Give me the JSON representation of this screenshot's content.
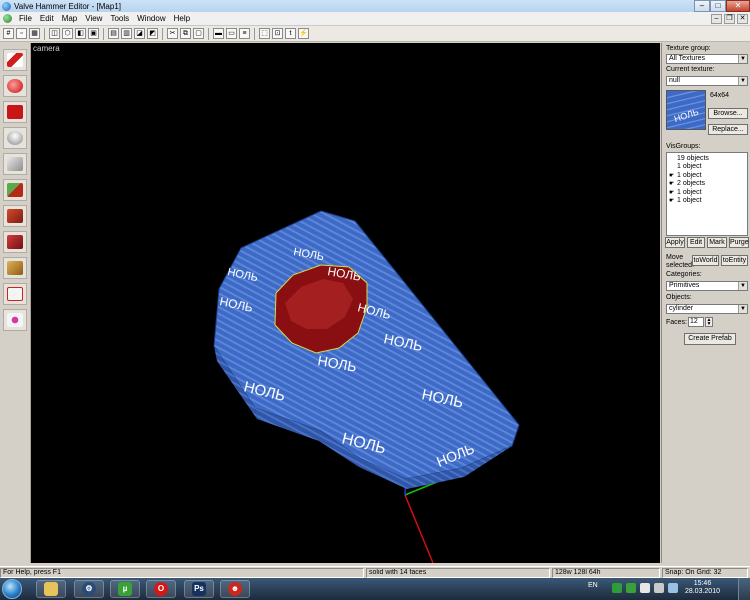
{
  "window": {
    "title": "Valve Hammer Editor - [Map1]"
  },
  "menu": [
    "File",
    "Edit",
    "Map",
    "View",
    "Tools",
    "Window",
    "Help"
  ],
  "viewport": {
    "label": "camera",
    "texture_text": "НОЛЬ"
  },
  "right_panel": {
    "texture_group_label": "Texture group:",
    "texture_group_value": "All Textures",
    "current_texture_label": "Current texture:",
    "current_texture_value": "null",
    "texture_size": "64x64",
    "browse_label": "Browse...",
    "replace_label": "Replace...",
    "visgroups_label": "VisGroups:",
    "visgroups": [
      {
        "text": "19 objects",
        "visible": false
      },
      {
        "text": "1 object",
        "visible": false
      },
      {
        "text": "1 object",
        "visible": true
      },
      {
        "text": "2 objects",
        "visible": true
      },
      {
        "text": "1 object",
        "visible": true
      },
      {
        "text": "1 object",
        "visible": true
      }
    ],
    "apply_label": "Apply",
    "edit_label": "Edit",
    "mark_label": "Mark",
    "purge_label": "Purge",
    "move_selected_line1": "Move",
    "move_selected_line2": "selected:",
    "to_world_label": "toWorld",
    "to_entity_label": "toEntity",
    "categories_label": "Categories:",
    "categories_value": "Primitives",
    "objects_label": "Objects:",
    "objects_value": "cylinder",
    "faces_label": "Faces:",
    "faces_value": "12",
    "create_prefab_label": "Create Prefab"
  },
  "status": {
    "help": "For Help, press F1",
    "selection": "solid with 14 faces",
    "size": "128w 128l 64h",
    "snap": "Snap: On Grid: 32"
  },
  "taskbar": {
    "lang": "EN",
    "time": "15:46",
    "date": "28.03.2010",
    "apps": [
      "explorer",
      "steam",
      "utorrent",
      "opera",
      "photoshop",
      "other"
    ]
  },
  "colors": {
    "texture_blue": "#3d6ac6",
    "selection_red": "#8a0f12",
    "selection_outline": "#d8d84a",
    "axis_x": "#d01010",
    "axis_y": "#12c012",
    "axis_z": "#1e3fd0"
  }
}
